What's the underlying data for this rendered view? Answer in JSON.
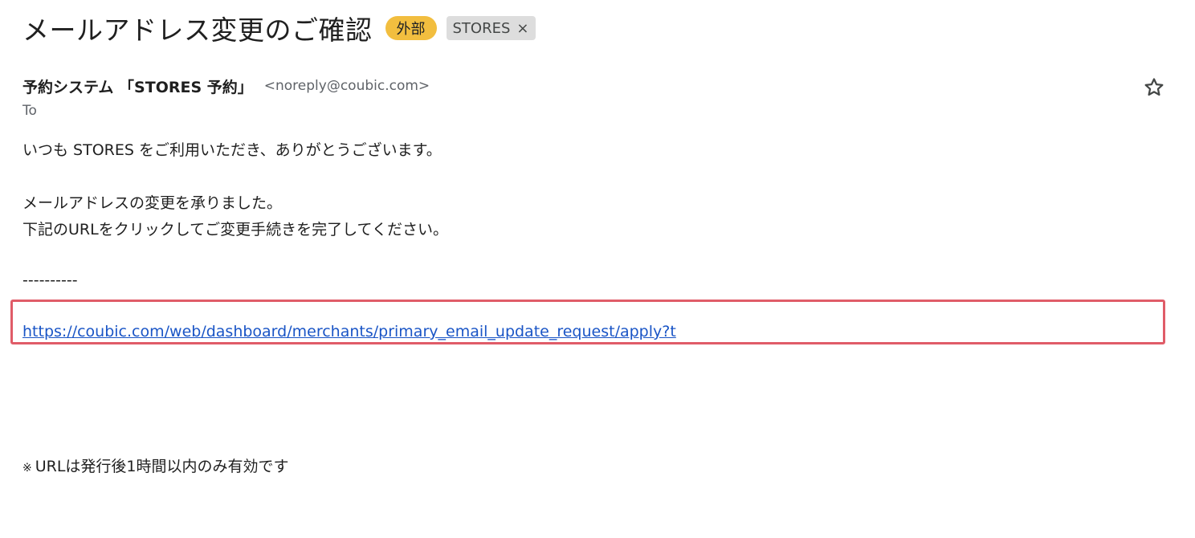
{
  "email": {
    "subject": "メールアドレス変更のご確認",
    "labels": {
      "external": "外部",
      "tag": "STORES",
      "tag_remove": "×"
    },
    "sender": {
      "name": "予約システム 「STORES 予約」",
      "email": "<noreply@coubic.com>"
    },
    "to_label": "To",
    "body": {
      "greeting": "いつも STORES をご利用いただき、ありがとうございます。",
      "line1": "メールアドレスの変更を承りました。",
      "line2": "下記のURLをクリックしてご変更手続きを完了してください。",
      "separator": "----------",
      "link": "https://coubic.com/web/dashboard/merchants/primary_email_update_request/apply?t",
      "note_mark": "※",
      "note": "URLは発行後1時間以内のみ有効です"
    }
  },
  "icons": {
    "star": "star-outline-icon",
    "remove": "close-icon"
  },
  "colors": {
    "external_label": "#f2be3f",
    "tag_label": "#dddddd",
    "link": "#1a55c6",
    "highlight": "#e05c68"
  }
}
